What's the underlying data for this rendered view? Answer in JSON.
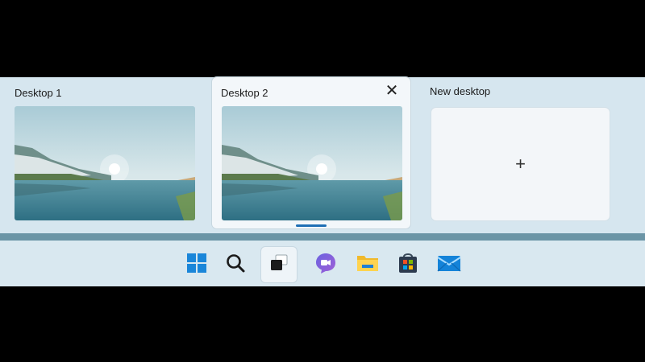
{
  "desktops": [
    {
      "title": "Desktop 1",
      "active": false
    },
    {
      "title": "Desktop 2",
      "active": true
    }
  ],
  "new_desktop": {
    "title": "New desktop",
    "plus": "+"
  },
  "close_glyph": "✕",
  "taskbar": {
    "icons": [
      "windows-start-icon",
      "search-icon",
      "task-view-icon",
      "teams-chat-icon",
      "file-explorer-icon",
      "microsoft-store-icon",
      "mail-icon"
    ],
    "active_icon": "task-view-icon"
  },
  "colors": {
    "panel": "#d6e6ef",
    "taskbar": "#d9e8f0",
    "divider": "#6b95a6",
    "indicator": "#1f6fb5"
  }
}
